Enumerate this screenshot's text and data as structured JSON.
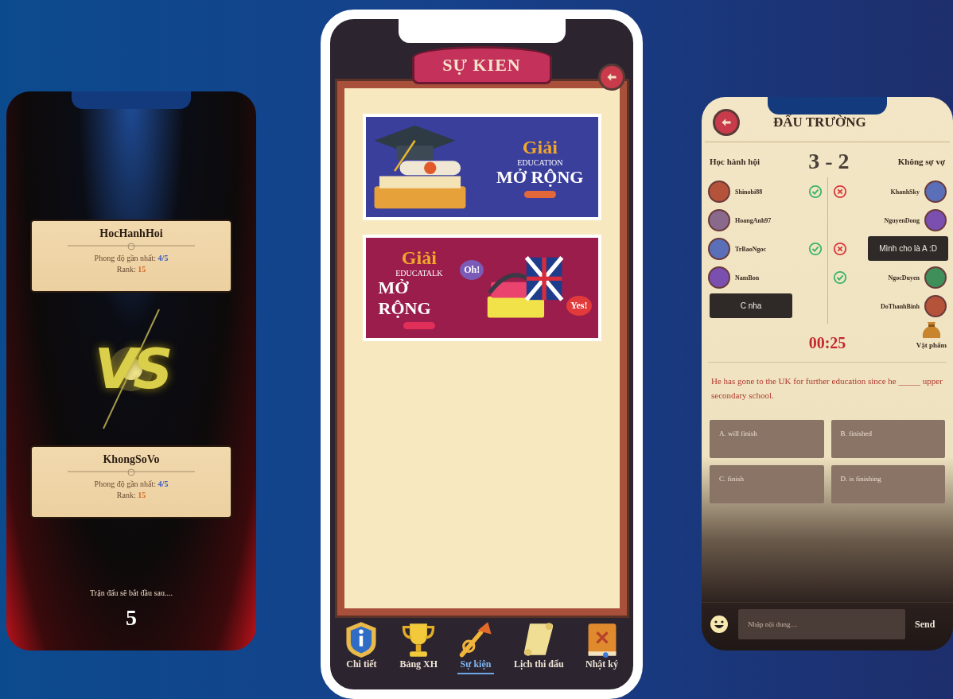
{
  "left_screen": {
    "players": [
      {
        "name": "HocHanhHoi",
        "form_label": "Phong độ gần nhất:",
        "form": "4/5",
        "rank_label": "Rank:",
        "rank": "15"
      },
      {
        "name": "KhongSoVo",
        "form_label": "Phong độ gần nhất:",
        "form": "4/5",
        "rank_label": "Rank:",
        "rank": "15"
      }
    ],
    "vs": "VS",
    "countdown_label": "Trận đấu sẽ bắt đầu sau....",
    "countdown": "5"
  },
  "middle_screen": {
    "title": "SỰ KIEN",
    "banners": [
      {
        "kind": "graduation",
        "color": "#3b3f9c",
        "prize": "Giải",
        "name": "EDUCATION",
        "subtitle": "MỞ RỘNG"
      },
      {
        "kind": "language",
        "color": "#9b1d4b",
        "prize": "Giải",
        "name": "EDUCATALK",
        "subtitle": "MỞ RỘNG",
        "stickers": [
          "Oh!",
          "Yes!"
        ]
      }
    ],
    "nav": [
      {
        "kind": "shield",
        "label": "Chi tiết",
        "selected": false
      },
      {
        "kind": "trophy",
        "label": "Bảng XH",
        "selected": false
      },
      {
        "kind": "horn",
        "label": "Sự kiện",
        "selected": true
      },
      {
        "kind": "scroll",
        "label": "Lịch thi đấu",
        "selected": false
      },
      {
        "kind": "book",
        "label": "Nhật ký",
        "selected": false
      }
    ]
  },
  "right_screen": {
    "title": "ĐẤU TRƯỜNG",
    "score": "3 - 2",
    "teams": [
      {
        "name": "Học hành hội",
        "chat_bubble": "C nha",
        "players": [
          {
            "name": "Shinobi88",
            "correct": true
          },
          {
            "name": "HoangAnh97"
          },
          {
            "name": "TrBaoNgoc",
            "correct": true
          },
          {
            "name": "NamBon"
          }
        ]
      },
      {
        "name": "Không sợ vợ",
        "chat_bubble": "Mình cho là A :D",
        "players": [
          {
            "name": "KhanhSky",
            "correct": false
          },
          {
            "name": "NguyenDong"
          },
          {
            "correct": false
          },
          {
            "name": "NgocDuyen",
            "correct": true
          },
          {
            "name": "DoThanhBinh"
          }
        ]
      }
    ],
    "timer": "00:25",
    "item_label": "Vật phẩm",
    "question": "He has gone to the UK for further education since he _____ upper secondary school.",
    "options": [
      "A. will finish",
      "B. finished",
      "C. finish",
      "D. is finishing"
    ],
    "chat": {
      "placeholder": "Nhập nội dung....",
      "send": "Send"
    }
  }
}
